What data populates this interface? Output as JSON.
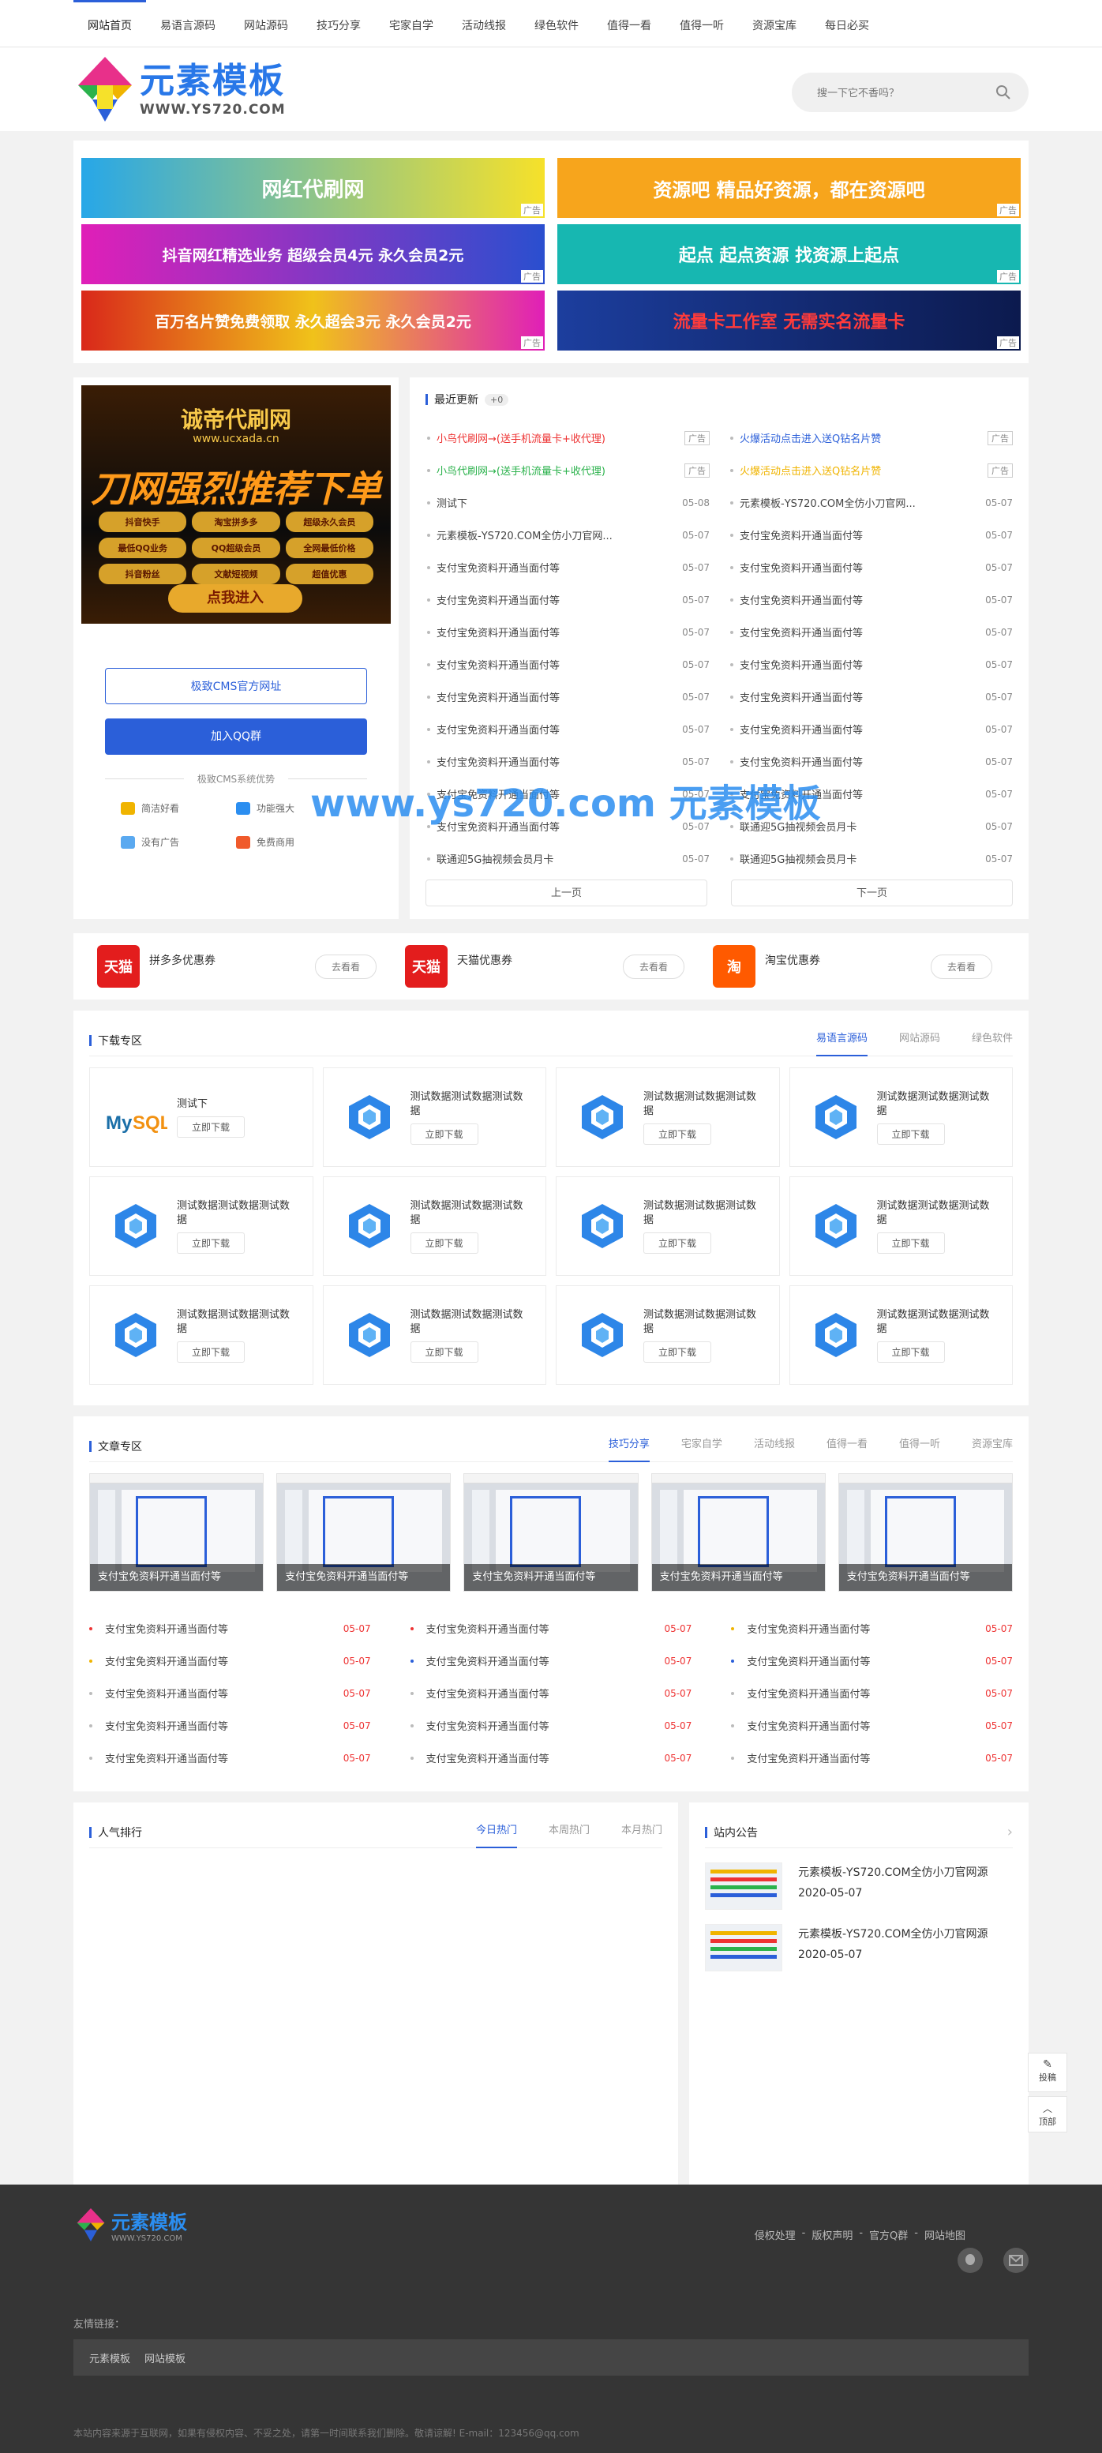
{
  "nav": [
    "网站首页",
    "易语言源码",
    "网站源码",
    "技巧分享",
    "宅家自学",
    "活动线报",
    "绿色软件",
    "值得一看",
    "值得一听",
    "资源宝库",
    "每日必买"
  ],
  "logo": {
    "cn": "元素模板",
    "en": "WWW.YS720.COM"
  },
  "search": {
    "placeholder": "搜一下它不香吗？"
  },
  "ads": {
    "a1": "网红代刷网",
    "a2": "资源吧  精品好资源，都在资源吧",
    "a3": "抖音网红精选业务  超级会员4元  永久会员2元",
    "a4": "起点  起点资源  找资源上起点",
    "a5": "百万名片赞免费领取  永久超会3元  永久会员2元",
    "a6": "流量卡工作室  无需实名流量卡",
    "tag": "广告"
  },
  "promo": {
    "title": "诚帝代刷网",
    "sub": "www.ucxada.cn",
    "big": "刀网强烈推荐下单",
    "tags": [
      "抖音快手",
      "淘宝拼多多",
      "超级永久会员",
      "最低QQ业务",
      "QQ超级会员",
      "全网最低价格",
      "抖音粉丝",
      "文献短视频",
      "超值优惠"
    ],
    "btn": "点我进入"
  },
  "left": {
    "btn1": "极致CMS官方网址",
    "btn2": "加入QQ群",
    "divider": "极致CMS系统优势",
    "features": [
      "简洁好看",
      "功能强大",
      "没有广告",
      "免费商用"
    ]
  },
  "updates": {
    "title": "最近更新",
    "count": "+0",
    "prev": "上一页",
    "next": "下一页",
    "items": [
      {
        "t": "小鸟代刷网→(送手机流量卡+收代理)",
        "d": "广告",
        "c": "#e33"
      },
      {
        "t": "火爆活动点击进入送Q钻名片赞",
        "d": "广告",
        "c": "#2b5fd9"
      },
      {
        "t": "小鸟代刷网→(送手机流量卡+收代理)",
        "d": "广告",
        "c": "#2bb24c"
      },
      {
        "t": "火爆活动点击进入送Q钻名片赞",
        "d": "广告",
        "c": "#f0b400"
      },
      {
        "t": "测试下",
        "d": "05-08",
        "c": ""
      },
      {
        "t": "元素模板-YS720.COM全仿小刀官网...",
        "d": "05-07",
        "c": ""
      },
      {
        "t": "元素模板-YS720.COM全仿小刀官网...",
        "d": "05-07",
        "c": ""
      },
      {
        "t": "支付宝免资料开通当面付等",
        "d": "05-07",
        "c": ""
      },
      {
        "t": "支付宝免资料开通当面付等",
        "d": "05-07",
        "c": ""
      },
      {
        "t": "支付宝免资料开通当面付等",
        "d": "05-07",
        "c": ""
      },
      {
        "t": "支付宝免资料开通当面付等",
        "d": "05-07",
        "c": ""
      },
      {
        "t": "支付宝免资料开通当面付等",
        "d": "05-07",
        "c": ""
      },
      {
        "t": "支付宝免资料开通当面付等",
        "d": "05-07",
        "c": ""
      },
      {
        "t": "支付宝免资料开通当面付等",
        "d": "05-07",
        "c": ""
      },
      {
        "t": "支付宝免资料开通当面付等",
        "d": "05-07",
        "c": ""
      },
      {
        "t": "支付宝免资料开通当面付等",
        "d": "05-07",
        "c": ""
      },
      {
        "t": "支付宝免资料开通当面付等",
        "d": "05-07",
        "c": ""
      },
      {
        "t": "支付宝免资料开通当面付等",
        "d": "05-07",
        "c": ""
      },
      {
        "t": "支付宝免资料开通当面付等",
        "d": "05-07",
        "c": ""
      },
      {
        "t": "支付宝免资料开通当面付等",
        "d": "05-07",
        "c": ""
      },
      {
        "t": "支付宝免资料开通当面付等",
        "d": "05-07",
        "c": ""
      },
      {
        "t": "支付宝免资料开通当面付等",
        "d": "05-07",
        "c": ""
      },
      {
        "t": "支付宝免资料开通当面付等",
        "d": "05-07",
        "c": ""
      },
      {
        "t": "支付宝免资料开通当面付等",
        "d": "05-07",
        "c": ""
      },
      {
        "t": "支付宝免资料开通当面付等",
        "d": "05-07",
        "c": ""
      },
      {
        "t": "联通迎5G抽视频会员月卡",
        "d": "05-07",
        "c": ""
      },
      {
        "t": "联通迎5G抽视频会员月卡",
        "d": "05-07",
        "c": ""
      },
      {
        "t": "联通迎5G抽视频会员月卡",
        "d": "05-07",
        "c": ""
      }
    ]
  },
  "watermark": "www.ys720.com 元素模板",
  "coupons": [
    {
      "icon": "天猫",
      "name": "拼多多优惠券",
      "btn": "去看看",
      "color": "#e31d1d"
    },
    {
      "icon": "天猫",
      "name": "天猫优惠券",
      "btn": "去看看",
      "color": "#e31d1d"
    },
    {
      "icon": "淘",
      "name": "淘宝优惠券",
      "btn": "去看看",
      "color": "#ff5a00"
    }
  ],
  "downloads": {
    "title": "下载专区",
    "tabs": [
      "易语言源码",
      "网站源码",
      "绿色软件"
    ],
    "btn": "立即下载",
    "items": [
      "测试下",
      "测试数据测试数据测试数据",
      "测试数据测试数据测试数据",
      "测试数据测试数据测试数据",
      "测试数据测试数据测试数据",
      "测试数据测试数据测试数据",
      "测试数据测试数据测试数据",
      "测试数据测试数据测试数据",
      "测试数据测试数据测试数据",
      "测试数据测试数据测试数据",
      "测试数据测试数据测试数据",
      "测试数据测试数据测试数据"
    ]
  },
  "articles": {
    "title": "文章专区",
    "tabs": [
      "技巧分享",
      "宅家自学",
      "活动线报",
      "值得一看",
      "值得一听",
      "资源宝库"
    ],
    "thumbs": [
      "支付宝免资料开通当面付等",
      "支付宝免资料开通当面付等",
      "支付宝免资料开通当面付等",
      "支付宝免资料开通当面付等",
      "支付宝免资料开通当面付等"
    ],
    "list": [
      {
        "t": "支付宝免资料开通当面付等",
        "d": "05-07",
        "c": "#e33"
      },
      {
        "t": "支付宝免资料开通当面付等",
        "d": "05-07",
        "c": "#e33"
      },
      {
        "t": "支付宝免资料开通当面付等",
        "d": "05-07",
        "c": "#f0b400"
      },
      {
        "t": "支付宝免资料开通当面付等",
        "d": "05-07",
        "c": "#f0b400"
      },
      {
        "t": "支付宝免资料开通当面付等",
        "d": "05-07",
        "c": "#2b5fd9"
      },
      {
        "t": "支付宝免资料开通当面付等",
        "d": "05-07",
        "c": "#2b5fd9"
      },
      {
        "t": "支付宝免资料开通当面付等",
        "d": "05-07",
        "c": "#bbb"
      },
      {
        "t": "支付宝免资料开通当面付等",
        "d": "05-07",
        "c": "#bbb"
      },
      {
        "t": "支付宝免资料开通当面付等",
        "d": "05-07",
        "c": "#bbb"
      },
      {
        "t": "支付宝免资料开通当面付等",
        "d": "05-07",
        "c": "#bbb"
      },
      {
        "t": "支付宝免资料开通当面付等",
        "d": "05-07",
        "c": "#bbb"
      },
      {
        "t": "支付宝免资料开通当面付等",
        "d": "05-07",
        "c": "#bbb"
      },
      {
        "t": "支付宝免资料开通当面付等",
        "d": "05-07",
        "c": "#bbb"
      },
      {
        "t": "支付宝免资料开通当面付等",
        "d": "05-07",
        "c": "#bbb"
      },
      {
        "t": "支付宝免资料开通当面付等",
        "d": "05-07",
        "c": "#bbb"
      }
    ]
  },
  "rank": {
    "title": "人气排行",
    "tabs": [
      "今日热门",
      "本周热门",
      "本月热门"
    ]
  },
  "notice": {
    "title": "站内公告",
    "items": [
      {
        "t": "元素模板-YS720.COM全仿小刀官网源",
        "d": "2020-05-07"
      },
      {
        "t": "元素模板-YS720.COM全仿小刀官网源",
        "d": "2020-05-07"
      }
    ]
  },
  "float": {
    "post": "投稿",
    "top": "顶部"
  },
  "footer": {
    "logo_cn": "元素模板",
    "logo_en": "WWW.YS720.COM",
    "links": [
      "侵权处理",
      "版权声明",
      "官方Q群",
      "网站地图"
    ],
    "friend_title": "友情链接：",
    "friends": [
      "元素模板",
      "网站模板"
    ],
    "copyright": "本站内容来源于互联网，如果有侵权内容、不妥之处，请第一时间联系我们删除。敬请谅解! E-mail：123456@qq.com"
  }
}
